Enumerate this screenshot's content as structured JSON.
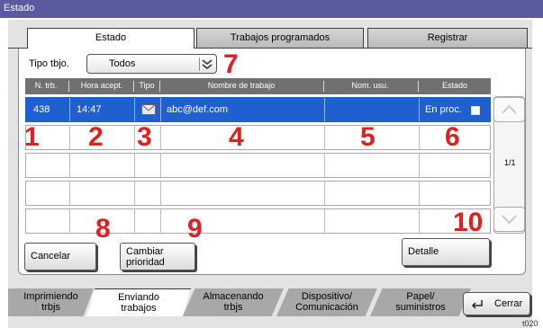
{
  "window": {
    "title": "Estado"
  },
  "tabs": [
    {
      "label": "Estado",
      "active": true
    },
    {
      "label": "Trabajos programados",
      "active": false
    },
    {
      "label": "Registrar",
      "active": false
    }
  ],
  "filter": {
    "label": "Tipo tbjo.",
    "value": "Todos"
  },
  "table": {
    "headers": [
      "N. trb.",
      "Hora acept.",
      "Tipo",
      "Nombre de trabajo",
      "Nom. usu.",
      "Estado"
    ],
    "rows": [
      {
        "job_no": "438",
        "time": "14:47",
        "type_icon": "email-icon",
        "name": "abc@def.com",
        "user": "",
        "status": "En proc.",
        "selected": true
      }
    ],
    "empty_rows": 4,
    "page": "1/1"
  },
  "callouts": [
    "1",
    "2",
    "3",
    "4",
    "5",
    "6",
    "7",
    "8",
    "9",
    "10"
  ],
  "buttons": {
    "cancel": "Cancelar",
    "change_priority": [
      "Cambiar",
      "prioridad"
    ],
    "detail": "Detalle"
  },
  "bottom_tabs": [
    {
      "line1": "Imprimiendo",
      "line2": "trbjs"
    },
    {
      "line1": "Enviando",
      "line2": "trabajos"
    },
    {
      "line1": "Almacenando",
      "line2": "trbjs"
    },
    {
      "line1": "Dispositivo/",
      "line2": "Comunicación"
    },
    {
      "line1": "Papel/",
      "line2": "suministros"
    }
  ],
  "close_button": "Cerrar",
  "image_code": "t020",
  "colors": {
    "title_bar": "#5a5aa0",
    "selected_row": "#1f5fd0",
    "callout": "#e02020",
    "header_bar": "#707070"
  }
}
